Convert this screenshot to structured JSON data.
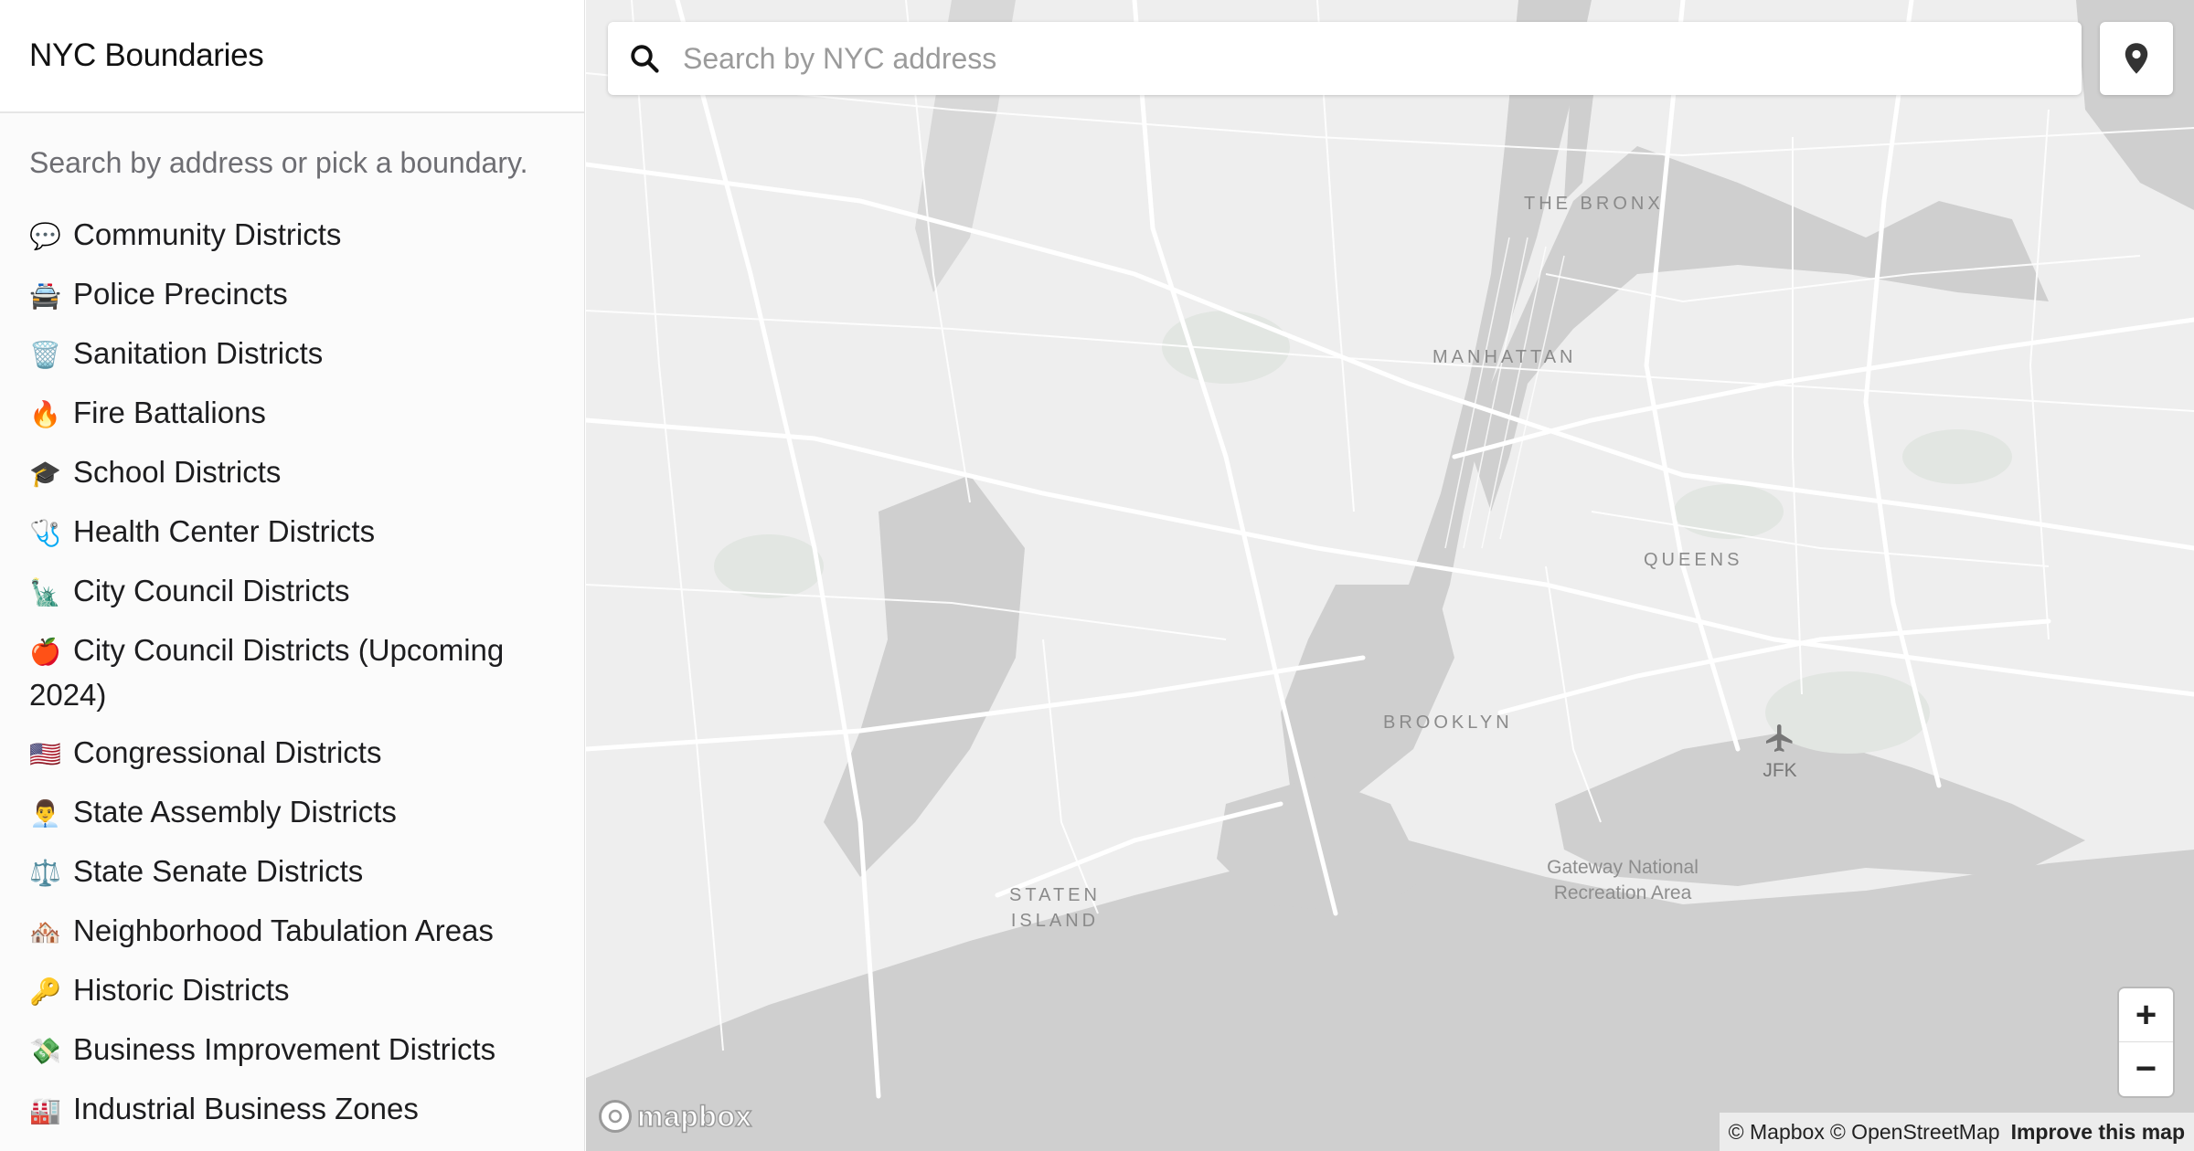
{
  "sidebar": {
    "title": "NYC Boundaries",
    "intro": "Search by address or pick a boundary.",
    "items": [
      {
        "emoji": "💬",
        "label": "Community Districts"
      },
      {
        "emoji": "🚔",
        "label": "Police Precincts"
      },
      {
        "emoji": "🗑️",
        "label": "Sanitation Districts"
      },
      {
        "emoji": "🔥",
        "label": "Fire Battalions"
      },
      {
        "emoji": "🎓",
        "label": "School Districts"
      },
      {
        "emoji": "🩺",
        "label": "Health Center Districts"
      },
      {
        "emoji": "🗽",
        "label": "City Council Districts"
      },
      {
        "emoji": "🍎",
        "label": "City Council Districts (Upcoming 2024)"
      },
      {
        "emoji": "🇺🇸",
        "label": "Congressional Districts"
      },
      {
        "emoji": "👨‍💼",
        "label": "State Assembly Districts"
      },
      {
        "emoji": "⚖️",
        "label": "State Senate Districts"
      },
      {
        "emoji": "🏘️",
        "label": "Neighborhood Tabulation Areas"
      },
      {
        "emoji": "🔑",
        "label": "Historic Districts"
      },
      {
        "emoji": "💸",
        "label": "Business Improvement Districts"
      },
      {
        "emoji": "🏭",
        "label": "Industrial Business Zones"
      }
    ]
  },
  "search": {
    "placeholder": "Search by NYC address"
  },
  "map": {
    "labels": {
      "bronx": "THE BRONX",
      "manhattan": "MANHATTAN",
      "queens": "QUEENS",
      "brooklyn": "BROOKLYN",
      "staten_island": "STATEN ISLAND",
      "gateway": "Gateway National Recreation Area",
      "airport": "JFK"
    },
    "zoom_in": "+",
    "zoom_out": "−",
    "logo": "mapbox",
    "attribution": {
      "mapbox": "© Mapbox",
      "osm": "© OpenStreetMap",
      "improve": "Improve this map"
    },
    "colors": {
      "land": "#eeeeee",
      "water": "#cfcfcf",
      "roads": "#ffffff",
      "parks": "#e2e6e2"
    }
  },
  "icons": {
    "search": "search-icon",
    "locate": "location-pin-icon",
    "airport": "airplane-icon"
  }
}
